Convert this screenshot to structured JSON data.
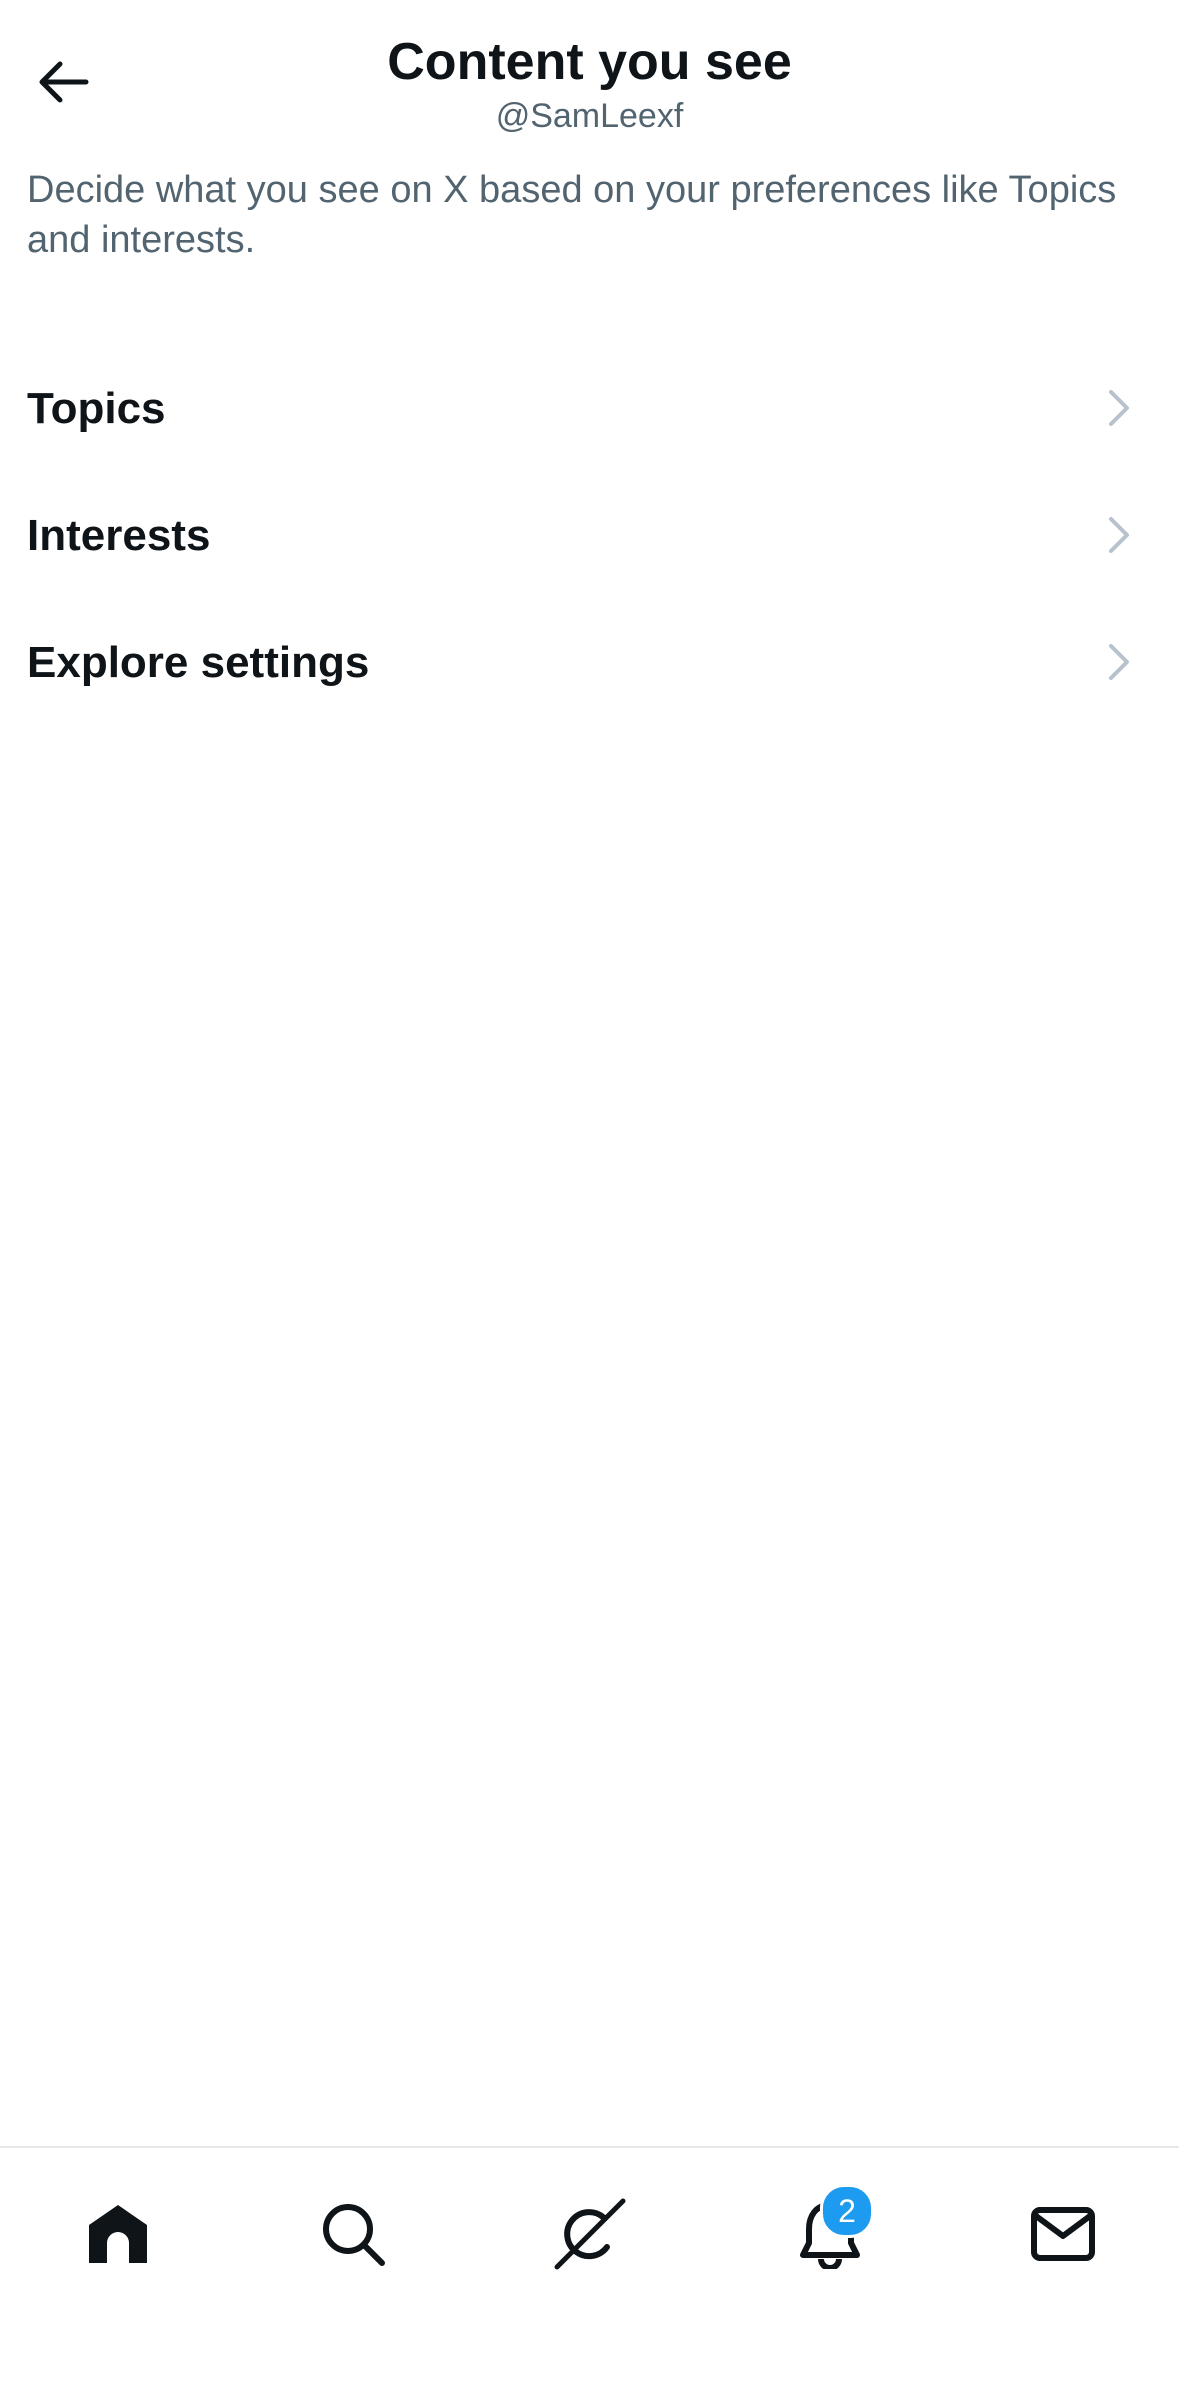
{
  "header": {
    "title": "Content you see",
    "handle": "@SamLeexf"
  },
  "description": "Decide what you see on X based on your preferences like Topics and interests.",
  "menu": {
    "items": [
      {
        "label": "Topics"
      },
      {
        "label": "Interests"
      },
      {
        "label": "Explore settings"
      }
    ]
  },
  "tabbar": {
    "notifications_badge": "2",
    "icons": [
      "home-icon",
      "search-icon",
      "grok-icon",
      "bell-icon",
      "mail-icon"
    ]
  },
  "colors": {
    "text_primary": "#0f1419",
    "text_secondary": "#536471",
    "chevron": "#b8c2cc",
    "accent": "#1d9bf0"
  }
}
